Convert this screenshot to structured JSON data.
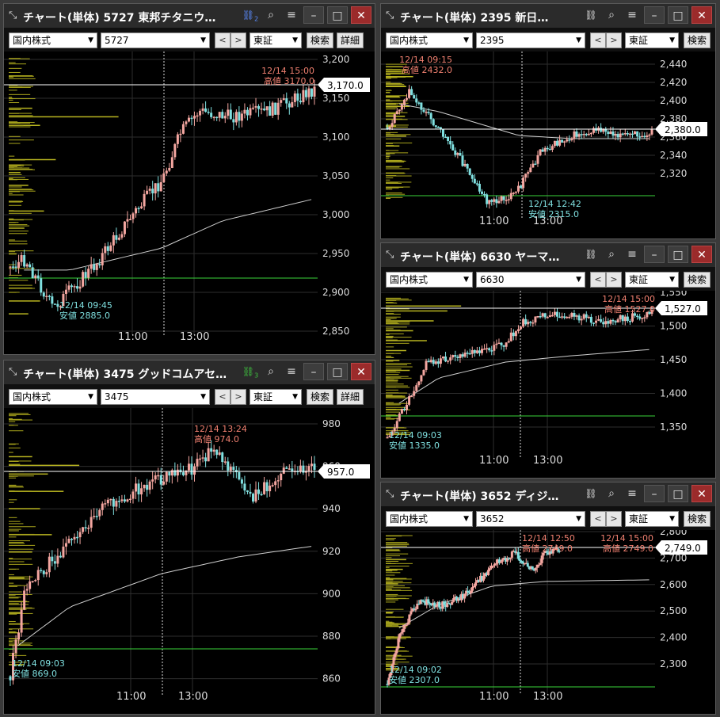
{
  "common": {
    "market": "国内株式",
    "exchange": "東証",
    "search_label": "検索",
    "detail_label": "詳細",
    "prev_label": "<",
    "next_label": ">"
  },
  "panels": [
    {
      "id": "p5727",
      "title": "チャート(単体) 5727 東邦チタニウ…",
      "code": "5727",
      "link_badge": "2",
      "show_detail": true,
      "y_ticks": [
        "3,200",
        "3,150",
        "3,100",
        "3,050",
        "3,000",
        "2,950",
        "2,900",
        "2,850"
      ],
      "x_ticks": [
        "11:00",
        "13:00"
      ],
      "high_time": "12/14 15:00",
      "high_label": "高値 3170.0",
      "low_time": "12/14 09:45",
      "low_label": "安値 2885.0",
      "current": "3,170.0",
      "colors": {
        "high": "#f08070",
        "low": "#7fe0e0",
        "support": "#3ad43a",
        "volume": "#b8b420",
        "vwap": "#cfcfcf"
      }
    },
    {
      "id": "p2395",
      "title": "チャート(単体) 2395 新日…",
      "code": "2395",
      "show_detail": false,
      "y_ticks": [
        "2,440",
        "2,420",
        "2,400",
        "2,380",
        "2,360",
        "2,340",
        "2,320"
      ],
      "x_ticks": [
        "11:00",
        "13:00"
      ],
      "high_time": "12/14 09:15",
      "high_label": "高値 2432.0",
      "low_time": "12/14 12:42",
      "low_label": "安値 2315.0",
      "current": "2,380.0"
    },
    {
      "id": "p3475",
      "title": "チャート(単体) 3475 グッドコムアセ…",
      "code": "3475",
      "link_badge": "3",
      "show_detail": true,
      "y_ticks": [
        "980",
        "960",
        "940",
        "920",
        "900",
        "880",
        "860"
      ],
      "x_ticks": [
        "11:00",
        "13:00"
      ],
      "high_time": "12/14 13:24",
      "high_label": "高値 974.0",
      "low_time": "12/14 09:03",
      "low_label": "安値 869.0",
      "current": "957.0"
    },
    {
      "id": "p6630",
      "title": "チャート(単体) 6630 ヤーマ…",
      "code": "6630",
      "show_detail": false,
      "y_ticks": [
        "1,550",
        "1,500",
        "1,450",
        "1,400",
        "1,350"
      ],
      "x_ticks": [
        "11:00",
        "13:00"
      ],
      "high_time": "12/14 15:00",
      "high_label": "高値 1527.0",
      "low_time": "12/14 09:03",
      "low_label": "安値 1335.0",
      "current": "1,527.0"
    },
    {
      "id": "p3652",
      "title": "チャート(単体) 3652 ディジ…",
      "code": "3652",
      "show_detail": false,
      "y_ticks": [
        "2,800",
        "2,700",
        "2,600",
        "2,500",
        "2,400",
        "2,300"
      ],
      "x_ticks": [
        "11:00",
        "13:00"
      ],
      "high_time": "12/14 12:50",
      "high_label": "高値 2749.0",
      "high_time2": "12/14 15:00",
      "high_label2": "高値 2749.0",
      "low_time": "12/14 09:02",
      "low_label": "安値 2307.0",
      "current": "2,749.0"
    }
  ]
}
